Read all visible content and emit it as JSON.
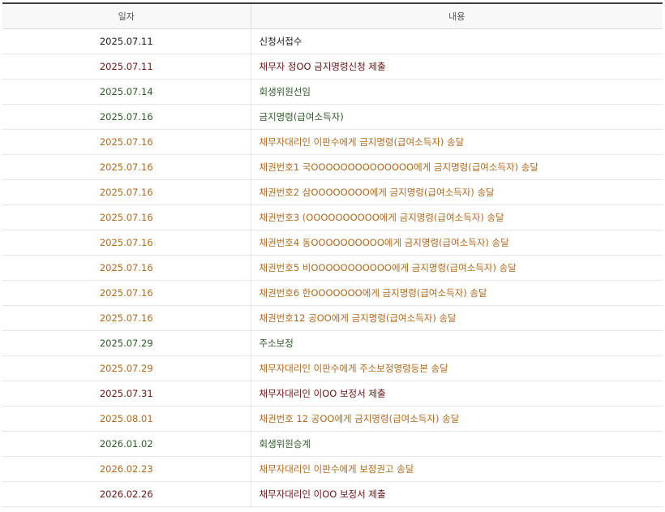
{
  "table": {
    "headers": {
      "date": "일자",
      "content": "내용"
    },
    "rows": [
      {
        "date": "2025.07.11",
        "content": "신청서접수",
        "color": "#1a1a1a"
      },
      {
        "date": "2025.07.11",
        "content": "채무자 정OO 금지명령신청 제출",
        "color": "#6b1414"
      },
      {
        "date": "2025.07.14",
        "content": "회생위원선임",
        "color": "#2d5a26"
      },
      {
        "date": "2025.07.16",
        "content": "금지명령(급여소득자)",
        "color": "#2d5a26"
      },
      {
        "date": "2025.07.16",
        "content": "채무자대리인 이판수에게 금지명령(급여소득자) 송달",
        "color": "#b06a1e"
      },
      {
        "date": "2025.07.16",
        "content": "채권번호1 국OOOOOOOOOOOOOO에게 금지명령(급여소득자) 송달",
        "color": "#b06a1e"
      },
      {
        "date": "2025.07.16",
        "content": "채권번호2 삼OOOOOOOO에게 금지명령(급여소득자) 송달",
        "color": "#b06a1e"
      },
      {
        "date": "2025.07.16",
        "content": "채권번호3 (OOOOOOOOOO에게 금지명령(급여소득자) 송달",
        "color": "#b06a1e"
      },
      {
        "date": "2025.07.16",
        "content": "채권번호4 동OOOOOOOOOO에게 금지명령(급여소득자) 송달",
        "color": "#b06a1e"
      },
      {
        "date": "2025.07.16",
        "content": "채권번호5 비OOOOOOOOOOO에게 금지명령(급여소득자) 송달",
        "color": "#b06a1e"
      },
      {
        "date": "2025.07.16",
        "content": "채권번호6 한OOOOOOO에게 금지명령(급여소득자) 송달",
        "color": "#b06a1e"
      },
      {
        "date": "2025.07.16",
        "content": "채권번호12 공OO에게 금지명령(급여소득자) 송달",
        "color": "#b06a1e"
      },
      {
        "date": "2025.07.29",
        "content": "주소보정",
        "color": "#2d5a26"
      },
      {
        "date": "2025.07.29",
        "content": "채무자대리인 이판수에게 주소보정명령등본 송달",
        "color": "#b06a1e"
      },
      {
        "date": "2025.07.31",
        "content": "채무자대리인 이OO 보정서 제출",
        "color": "#6b1414"
      },
      {
        "date": "2025.08.01",
        "content": "채권번호 12 공OO에게 금지명령(급여소득자) 송달",
        "color": "#b06a1e"
      },
      {
        "date": "2026.01.02",
        "content": "회생위원승계",
        "color": "#2d5a26"
      },
      {
        "date": "2026.02.23",
        "content": "채무자대리인 이판수에게 보정권고 송달",
        "color": "#b06a1e"
      },
      {
        "date": "2026.02.26",
        "content": "채무자대리인 이OO 보정서 제출",
        "color": "#6b1414"
      }
    ]
  }
}
